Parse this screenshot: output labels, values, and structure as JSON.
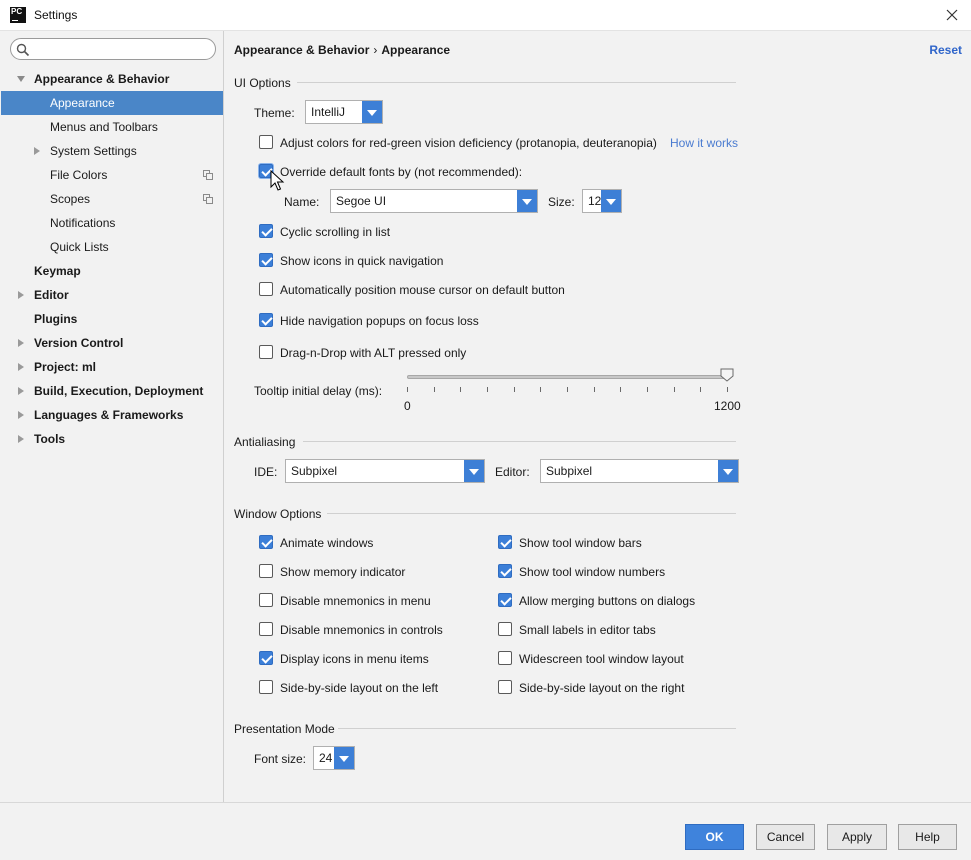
{
  "window": {
    "title": "Settings",
    "app_icon": "PC"
  },
  "sidebar": {
    "search_placeholder": "",
    "items": [
      {
        "label": "Appearance & Behavior"
      },
      {
        "label": "Appearance"
      },
      {
        "label": "Menus and Toolbars"
      },
      {
        "label": "System Settings"
      },
      {
        "label": "File Colors"
      },
      {
        "label": "Scopes"
      },
      {
        "label": "Notifications"
      },
      {
        "label": "Quick Lists"
      },
      {
        "label": "Keymap"
      },
      {
        "label": "Editor"
      },
      {
        "label": "Plugins"
      },
      {
        "label": "Version Control"
      },
      {
        "label": "Project: ml"
      },
      {
        "label": "Build, Execution, Deployment"
      },
      {
        "label": "Languages & Frameworks"
      },
      {
        "label": "Tools"
      }
    ]
  },
  "main": {
    "breadcrumb": {
      "parent": "Appearance & Behavior",
      "separator": "›",
      "current": "Appearance"
    },
    "reset": "Reset",
    "ui_options": {
      "title": "UI Options",
      "theme_label": "Theme:",
      "theme_value": "IntelliJ",
      "red_green_label": "Adjust colors for red-green vision deficiency (protanopia, deuteranopia)",
      "how_it_works": "How it works",
      "override_fonts_label": "Override default fonts by (not recommended):",
      "font_name_label": "Name:",
      "font_name_value": "Segoe UI",
      "font_size_label": "Size:",
      "font_size_value": "12",
      "cyclic_scrolling": "Cyclic scrolling in list",
      "show_icons_quick_nav": "Show icons in quick navigation",
      "auto_position_cursor": "Automatically position mouse cursor on default button",
      "hide_nav_popups": "Hide navigation popups on focus loss",
      "drag_n_drop_alt": "Drag-n-Drop with ALT pressed only",
      "tooltip_delay_label": "Tooltip initial delay (ms):",
      "tooltip_min": "0",
      "tooltip_max": "1200",
      "tooltip_value": 1200
    },
    "antialiasing": {
      "title": "Antialiasing",
      "ide_label": "IDE:",
      "ide_value": "Subpixel",
      "editor_label": "Editor:",
      "editor_value": "Subpixel"
    },
    "window_options": {
      "title": "Window Options",
      "left": [
        "Animate windows",
        "Show memory indicator",
        "Disable mnemonics in menu",
        "Disable mnemonics in controls",
        "Display icons in menu items",
        "Side-by-side layout on the left"
      ],
      "right": [
        "Show tool window bars",
        "Show tool window numbers",
        "Allow merging buttons on dialogs",
        "Small labels in editor tabs",
        "Widescreen tool window layout",
        "Side-by-side layout on the right"
      ]
    },
    "presentation_mode": {
      "title": "Presentation Mode",
      "font_size_label": "Font size:",
      "font_size_value": "24"
    }
  },
  "footer": {
    "ok": "OK",
    "cancel": "Cancel",
    "apply": "Apply",
    "help": "Help"
  },
  "colors": {
    "selection": "#4a86c8",
    "accent": "#3d7fd6",
    "link": "#4a7bd0",
    "reset": "#2f65ca"
  }
}
